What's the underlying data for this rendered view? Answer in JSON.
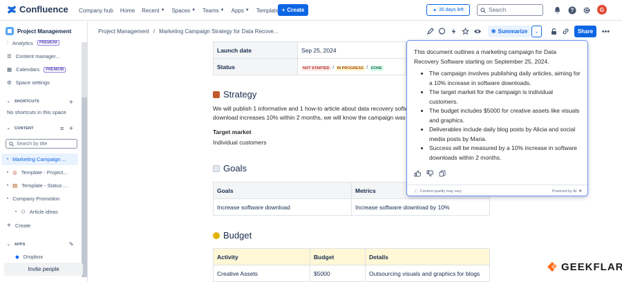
{
  "app": {
    "name": "Confluence"
  },
  "topnav": {
    "items": [
      "Company hub",
      "Home",
      "Recent",
      "Spaces",
      "Teams",
      "Apps",
      "Templates"
    ],
    "create_label": "Create",
    "trial_label": "30 days left",
    "search_placeholder": "Search",
    "avatar_letter": "G"
  },
  "sidebar": {
    "space_name": "Project Management",
    "items": [
      {
        "label": "Analytics",
        "badge": "PREMIUM"
      },
      {
        "label": "Content manager..."
      },
      {
        "label": "Calendars",
        "badge": "PREMIUM"
      },
      {
        "label": "Space settings"
      }
    ],
    "shortcuts_label": "SHORTCUTS",
    "shortcuts_empty": "No shortcuts in this space",
    "content_label": "CONTENT",
    "search_placeholder": "Search by title",
    "tree": [
      "Marketing Campaign ...",
      "Template - Project...",
      "Template - Status ...",
      "Company Promotion",
      "Article ideas"
    ],
    "create_label": "Create",
    "apps_label": "APPS",
    "apps_item": "Dropbox",
    "invite_label": "Invite people"
  },
  "page": {
    "breadcrumb": [
      "Project Management",
      "/",
      "Marketing Campaign Strategy for Data Recove..."
    ],
    "summarize_label": "Summarize",
    "share_label": "Share",
    "meta": {
      "launch_key": "Launch date",
      "launch_value": "Sep 25, 2024",
      "status_key": "Status",
      "status_values": [
        "NOT STARTED",
        "/",
        "IN PROGRESS",
        "/",
        "DONE"
      ]
    },
    "strategy": {
      "heading": "Strategy",
      "line1": "We will publish 1 informative and 1 how-to article about data recovery softw",
      "line2": "download increases 10% within 2 months, we will know the campaign was s",
      "target_heading": "Target market",
      "target_value": "Individual customers"
    },
    "goals": {
      "heading": "Goals",
      "headers": [
        "Goals",
        "Metrics"
      ],
      "row": [
        "Increase software download",
        "Increase software download by 10%"
      ]
    },
    "budget": {
      "heading": "Budget",
      "headers": [
        "Activity",
        "Budget",
        "Details"
      ],
      "row": [
        "Creative Assets",
        "$5000",
        "Outsourcing visuals and graphics for blogs"
      ]
    }
  },
  "summary_popup": {
    "intro": "This document outlines a marketing campaign for Data Recovery Software starting on September 25, 2024.",
    "bullets": [
      "The campaign involves publishing daily articles, aiming for a 10% increase in software downloads.",
      "The target market for the campaign is individual customers.",
      "The budget includes $5000 for creative assets like visuals and graphics.",
      "Deliverables include daily blog posts by Alicia and social media posts by Maria.",
      "Success will be measured by a 10% increase in software downloads within 2 months."
    ],
    "quality_note": "Content quality may vary",
    "powered_by": "Powered by AI"
  },
  "watermark": {
    "text": "GEEKFLARE"
  },
  "colors": {
    "brand_blue": "#0c66e4",
    "watermark_orange": "#ff6a13",
    "status_red": "#ae2e24",
    "status_yellow": "#a54800",
    "status_green": "#216e4e"
  }
}
